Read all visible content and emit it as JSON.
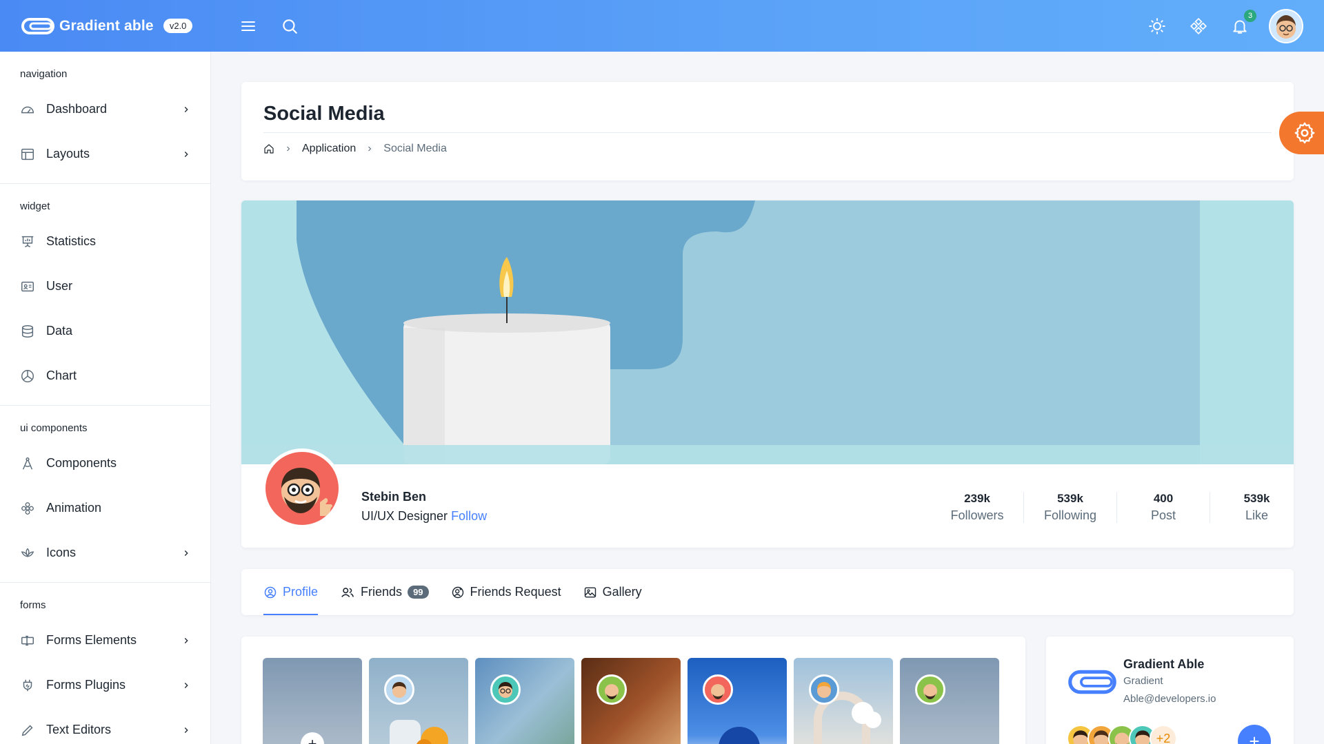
{
  "app": {
    "name": "Gradient able",
    "version": "v2.0"
  },
  "header": {
    "notifications_count": "3"
  },
  "sidebar": {
    "groups": [
      {
        "caption": "navigation",
        "items": [
          {
            "label": "Dashboard",
            "icon": "dashboard-icon",
            "chevron": true
          },
          {
            "label": "Layouts",
            "icon": "layout-icon",
            "chevron": true
          }
        ]
      },
      {
        "caption": "widget",
        "items": [
          {
            "label": "Statistics",
            "icon": "presentation-icon"
          },
          {
            "label": "User",
            "icon": "id-card-icon"
          },
          {
            "label": "Data",
            "icon": "database-icon"
          },
          {
            "label": "Chart",
            "icon": "pie-chart-icon"
          }
        ]
      },
      {
        "caption": "ui components",
        "items": [
          {
            "label": "Components",
            "icon": "compass-icon"
          },
          {
            "label": "Animation",
            "icon": "flower-icon"
          },
          {
            "label": "Icons",
            "icon": "lotus-icon",
            "chevron": true
          }
        ]
      },
      {
        "caption": "forms",
        "items": [
          {
            "label": "Forms Elements",
            "icon": "input-icon",
            "chevron": true
          },
          {
            "label": "Forms Plugins",
            "icon": "plugin-icon",
            "chevron": true
          },
          {
            "label": "Text Editors",
            "icon": "pen-icon",
            "chevron": true
          }
        ]
      }
    ]
  },
  "page": {
    "title": "Social Media",
    "breadcrumb": [
      "Application",
      "Social Media"
    ]
  },
  "profile": {
    "name": "Stebin Ben",
    "role": "UI/UX Designer",
    "follow_label": "Follow",
    "stats": [
      {
        "value": "239k",
        "label": "Followers"
      },
      {
        "value": "539k",
        "label": "Following"
      },
      {
        "value": "400",
        "label": "Post"
      },
      {
        "value": "539k",
        "label": "Like"
      }
    ]
  },
  "tabs": [
    {
      "label": "Profile",
      "icon": "user-circle-icon",
      "active": true
    },
    {
      "label": "Friends",
      "icon": "users-icon",
      "badge": "99"
    },
    {
      "label": "Friends Request",
      "icon": "user-plus-icon"
    },
    {
      "label": "Gallery",
      "icon": "image-icon"
    }
  ],
  "brand_card": {
    "title": "Gradient Able",
    "subtitle": "Gradient",
    "email": "Able@developers.io",
    "more_count": "+2"
  },
  "colors": {
    "primary": "#4680ff",
    "accent_orange": "#f4772e",
    "success": "#2ca87f"
  }
}
